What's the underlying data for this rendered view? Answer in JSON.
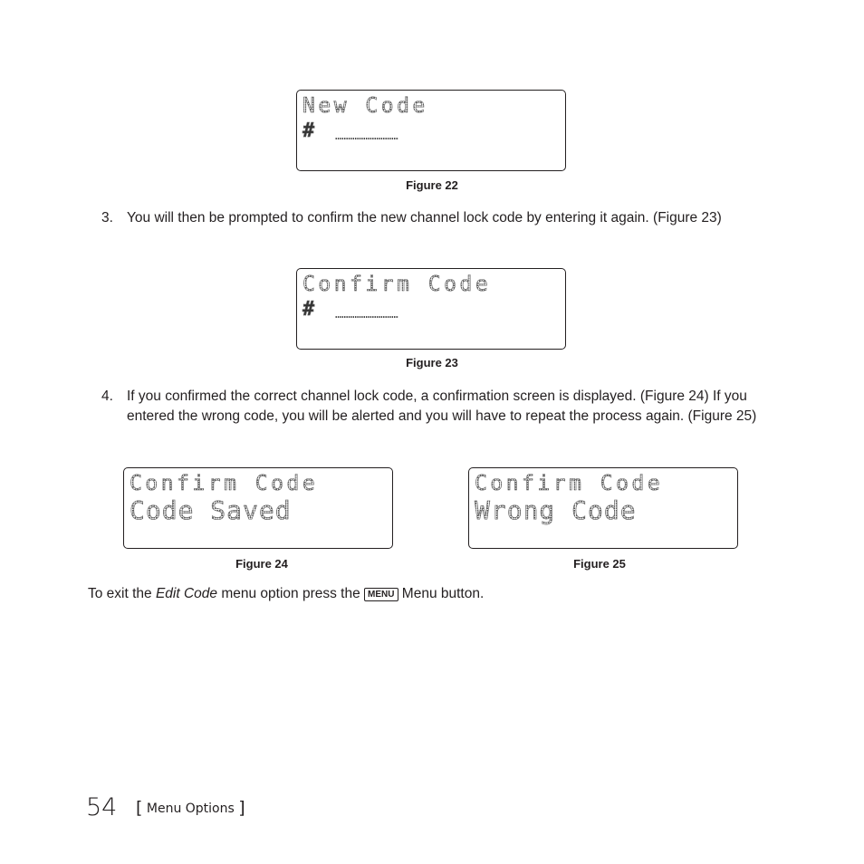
{
  "figures": [
    {
      "id": "figure-22",
      "caption": "Figure 22",
      "line1": "New Code",
      "line2": "",
      "show_hash_entry": true
    },
    {
      "id": "figure-23",
      "caption": "Figure 23",
      "line1": "Confirm Code",
      "line2": "",
      "show_hash_entry": true
    },
    {
      "id": "figure-24",
      "caption": "Figure 24",
      "line1": "Confirm Code",
      "line2": "Code Saved",
      "show_hash_entry": false
    },
    {
      "id": "figure-25",
      "caption": "Figure 25",
      "line1": "Confirm Code",
      "line2": "Wrong Code",
      "show_hash_entry": false
    }
  ],
  "hash_symbol": "#",
  "steps": [
    {
      "number": "3.",
      "text": "You will then be prompted to confirm the new channel lock code by entering it again. (Figure 23)"
    },
    {
      "number": "4.",
      "text": "If you confirmed the correct channel lock code, a confirmation screen is displayed. (Figure 24) If you entered the wrong code, you will be alerted and you will have to repeat the process again. (Figure 25)"
    }
  ],
  "exit_instruction": {
    "prefix": "To exit the ",
    "emphasis": "Edit Code",
    "middle": " menu option press the ",
    "key_label": "MENU",
    "suffix": " Menu button."
  },
  "footer": {
    "page_number": "54",
    "bracket_open": "[",
    "section": "Menu Options",
    "bracket_close": "]"
  }
}
